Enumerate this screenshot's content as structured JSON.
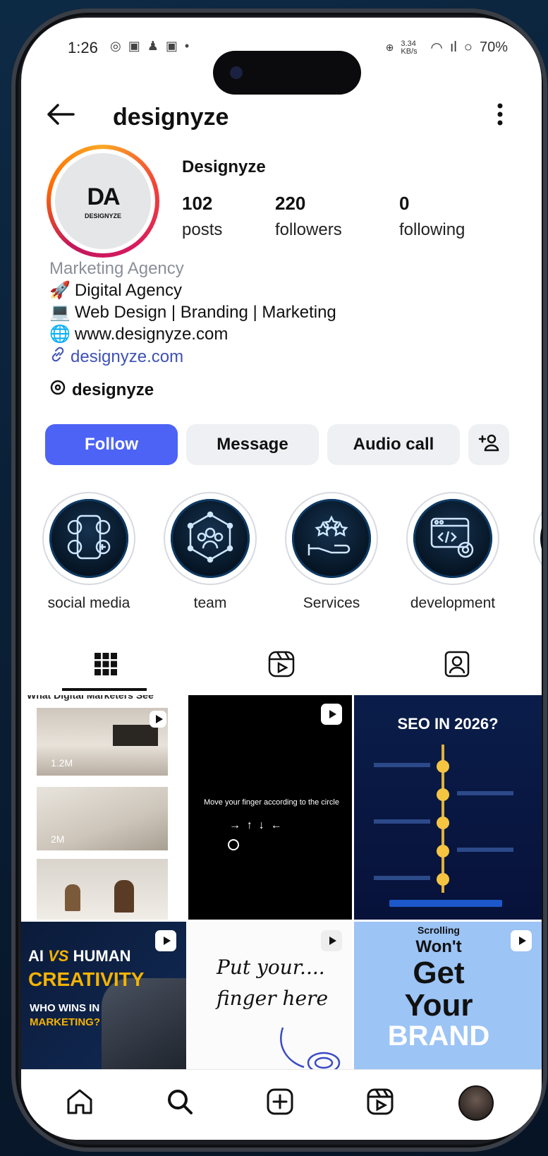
{
  "status": {
    "time": "1:26",
    "battery": "70%",
    "speed": "3.34 KB/s"
  },
  "header": {
    "username": "designyze"
  },
  "profile": {
    "display_name": "Designyze",
    "logo_mark": "DA",
    "logo_text": "DESIGNYZE",
    "stats": [
      {
        "value": "102",
        "label": "posts"
      },
      {
        "value": "220",
        "label": "followers"
      },
      {
        "value": "0",
        "label": "following"
      }
    ],
    "category": "Marketing Agency",
    "bio_lines": [
      {
        "icon": "rocket-icon",
        "glyph": "🚀",
        "text": "Digital Agency"
      },
      {
        "icon": "laptop-icon",
        "glyph": "💻",
        "text": "Web Design | Branding | Marketing"
      },
      {
        "icon": "globe-icon",
        "glyph": "🌐",
        "text": "www.designyze.com"
      }
    ],
    "link": "designyze.com",
    "threads_handle": "designyze"
  },
  "actions": {
    "follow": "Follow",
    "message": "Message",
    "audio_call": "Audio call"
  },
  "highlights": [
    {
      "label": "social media",
      "icon": "social-media-icon"
    },
    {
      "label": "team",
      "icon": "team-icon"
    },
    {
      "label": "Services",
      "icon": "services-icon"
    },
    {
      "label": "development",
      "icon": "development-icon"
    }
  ],
  "posts": {
    "t1": {
      "header": "What Digital Marketers See",
      "view1": "1.2M",
      "view2": "2M"
    },
    "t2": {
      "caption": "Move your finger according to the circle",
      "arrows": "→  ↑  ↓  ←"
    },
    "t3": {
      "title": "SEO IN 2026?"
    },
    "t4": {
      "line1_a": "AI ",
      "line1_vs": "VS",
      "line1_b": " HUMAN",
      "line2": "CREATIVITY",
      "line3": "WHO WINS IN",
      "line4": "MARKETING?"
    },
    "t5": {
      "line1": "Put your....",
      "line2": "finger here"
    },
    "t6": {
      "line1": "Scrolling",
      "line2": "Won't",
      "line3": "Get",
      "line4": "Your",
      "line5": "BRAND"
    }
  },
  "colors": {
    "accent": "#4c63f6",
    "link": "#3f51b5",
    "highlight_bg": "#051423"
  }
}
